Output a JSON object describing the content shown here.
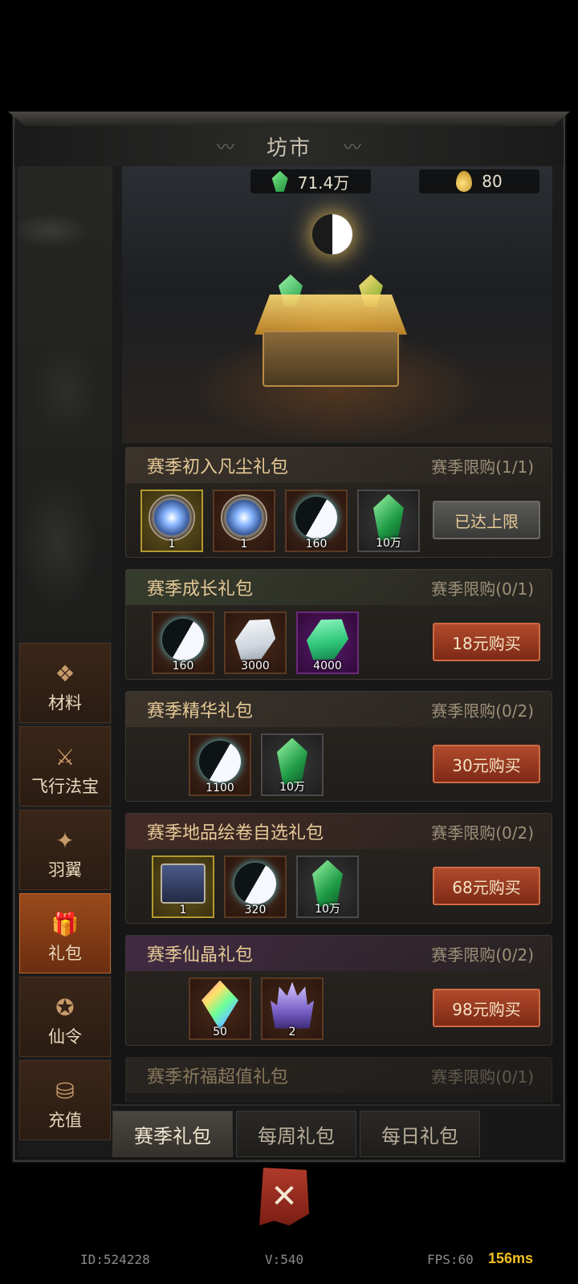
{
  "title": "坊市",
  "currencies": {
    "jade": "71.4万",
    "coin": "80"
  },
  "nav": [
    {
      "label": "材料",
      "icon": "❖"
    },
    {
      "label": "飞行法宝",
      "icon": "⚔"
    },
    {
      "label": "羽翼",
      "icon": "✦"
    },
    {
      "label": "礼包",
      "icon": "🎁"
    },
    {
      "label": "仙令",
      "icon": "✪"
    },
    {
      "label": "充值",
      "icon": "⛁"
    }
  ],
  "packages": [
    {
      "title": "赛季初入凡尘礼包",
      "limit": "赛季限购(1/1)",
      "button": "已达上限",
      "items": [
        {
          "icon": "portal",
          "count": "1"
        },
        {
          "icon": "portal",
          "count": "1"
        },
        {
          "icon": "taiji",
          "count": "160"
        },
        {
          "icon": "jade",
          "count": "10万"
        }
      ]
    },
    {
      "title": "赛季成长礼包",
      "limit": "赛季限购(0/1)",
      "button": "18元购买",
      "items": [
        {
          "icon": "taiji",
          "count": "160"
        },
        {
          "icon": "white-crystal",
          "count": "3000"
        },
        {
          "icon": "emerald",
          "count": "4000"
        }
      ]
    },
    {
      "title": "赛季精华礼包",
      "limit": "赛季限购(0/2)",
      "button": "30元购买",
      "items": [
        {
          "icon": "taiji",
          "count": "1100"
        },
        {
          "icon": "jade",
          "count": "10万"
        }
      ]
    },
    {
      "title": "赛季地品绘卷自选礼包",
      "limit": "赛季限购(0/2)",
      "button": "68元购买",
      "items": [
        {
          "icon": "chest",
          "count": "1"
        },
        {
          "icon": "taiji",
          "count": "320"
        },
        {
          "icon": "jade",
          "count": "10万"
        }
      ]
    },
    {
      "title": "赛季仙晶礼包",
      "limit": "赛季限购(0/2)",
      "button": "98元购买",
      "items": [
        {
          "icon": "rainbow-crystal",
          "count": "50"
        },
        {
          "icon": "crystal-cluster",
          "count": "2"
        }
      ]
    },
    {
      "title": "赛季祈福超值礼包",
      "limit": "赛季限购(0/1)"
    }
  ],
  "tabs": [
    "赛季礼包",
    "每周礼包",
    "每日礼包"
  ],
  "debug": {
    "id": "ID:524228",
    "version": "V:540",
    "fps": "FPS:60",
    "ms": "156ms"
  }
}
